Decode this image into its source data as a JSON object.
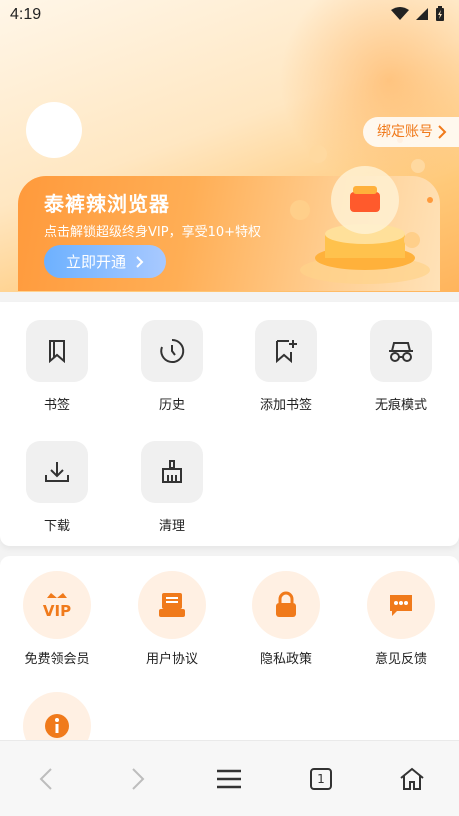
{
  "status_bar": {
    "time": "4:19"
  },
  "header": {
    "bind_account_label": "绑定账号",
    "vip_card": {
      "title": "泰裤辣浏览器",
      "subtitle": "点击解锁超级终身VIP，享受10+特权",
      "button_label": "立即开通"
    }
  },
  "quick_menu": {
    "items": [
      {
        "label": "书签",
        "icon": "bookmark-icon"
      },
      {
        "label": "历史",
        "icon": "history-icon"
      },
      {
        "label": "添加书签",
        "icon": "add-bookmark-icon"
      },
      {
        "label": "无痕模式",
        "icon": "incognito-icon"
      },
      {
        "label": "下载",
        "icon": "download-icon"
      },
      {
        "label": "清理",
        "icon": "broom-icon"
      }
    ]
  },
  "service_menu": {
    "items": [
      {
        "label": "免费领会员",
        "icon": "vip-crown-icon"
      },
      {
        "label": "用户协议",
        "icon": "document-icon"
      },
      {
        "label": "隐私政策",
        "icon": "lock-icon"
      },
      {
        "label": "意见反馈",
        "icon": "chat-icon"
      },
      {
        "label": "",
        "icon": "info-icon"
      }
    ]
  },
  "bottom_nav": {
    "tab_count": "1",
    "items": [
      "back-icon",
      "forward-icon",
      "menu-icon",
      "tabs-icon",
      "home-icon"
    ]
  },
  "colors": {
    "accent_orange": "#f07a1b",
    "vip_button": "#6db1ff",
    "tile_bg": "#f0f0f0",
    "orange_tile_bg": "#fff0e3"
  }
}
